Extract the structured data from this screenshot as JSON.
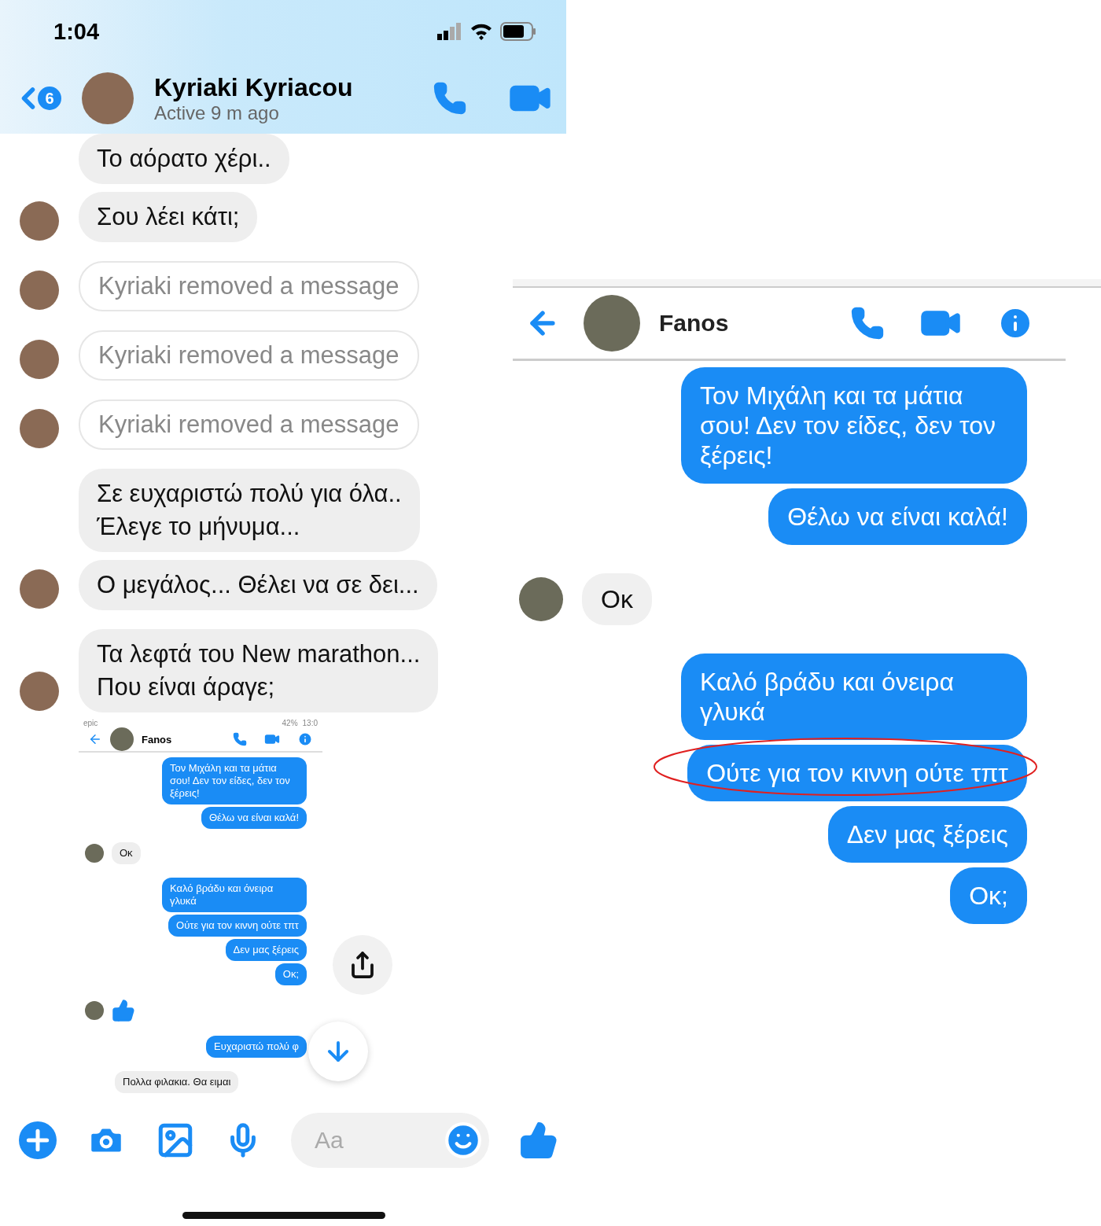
{
  "status_bar": {
    "time": "1:04"
  },
  "header": {
    "back_count": "6",
    "name": "Kyriaki Kyriacou",
    "status": "Active 9 m ago"
  },
  "messages": [
    {
      "kind": "text",
      "avatar": false,
      "text": "Το αόρατο χέρι.."
    },
    {
      "kind": "text",
      "avatar": true,
      "text": "Σου λέει κάτι;"
    },
    {
      "kind": "removed",
      "avatar": true,
      "text": "Kyriaki removed a message"
    },
    {
      "kind": "removed",
      "avatar": true,
      "text": "Kyriaki removed a message"
    },
    {
      "kind": "removed",
      "avatar": true,
      "text": "Kyriaki removed a message"
    },
    {
      "kind": "text",
      "avatar": false,
      "text": "Σε ευχαριστώ πολύ για όλα..\nΈλεγε το μήνυμα..."
    },
    {
      "kind": "text",
      "avatar": true,
      "text": "Ο μεγάλος... Θέλει να σε δει..."
    },
    {
      "kind": "text",
      "avatar": true,
      "text": "Τα λεφτά του New marathon...\nΠου είναι άραγε;"
    }
  ],
  "shared_screenshot": {
    "status_left": "epic",
    "battery": "42%",
    "time": "13:0",
    "contact": "Fanos",
    "messages": [
      {
        "kind": "sent",
        "text": "Τον Μιχάλη και τα μάτια σου! Δεν τον είδες, δεν τον ξέρεις!"
      },
      {
        "kind": "sent",
        "text": "Θέλω να είναι καλά!"
      },
      {
        "kind": "received",
        "text": "Οκ"
      },
      {
        "kind": "sent",
        "text": "Καλό βράδυ και όνειρα γλυκά"
      },
      {
        "kind": "sent",
        "text": "Ούτε για τον κιννη ούτε τπτ"
      },
      {
        "kind": "sent",
        "text": "Δεν μας ξέρεις"
      },
      {
        "kind": "sent",
        "text": "Οκ;"
      },
      {
        "kind": "like"
      },
      {
        "kind": "sent",
        "text": "Ευχαριστώ πολύ φ"
      },
      {
        "kind": "received",
        "text": "Πολλα φιλακια. Θα ειμαι"
      }
    ]
  },
  "composer": {
    "placeholder": "Aa"
  },
  "zoomed_screenshot": {
    "contact": "Fanos",
    "messages": [
      {
        "kind": "sent",
        "text": "Τον Μιχάλη και τα μάτια σου! Δεν τον είδες, δεν τον ξέρεις!",
        "highlighted": false
      },
      {
        "kind": "sent",
        "text": "Θέλω να είναι καλά!",
        "highlighted": false
      },
      {
        "kind": "received",
        "text": "Οκ",
        "highlighted": false
      },
      {
        "kind": "sent",
        "text": "Καλό βράδυ και όνειρα γλυκά",
        "highlighted": false
      },
      {
        "kind": "sent",
        "text": "Ούτε για τον κιννη ούτε τπτ",
        "highlighted": true
      },
      {
        "kind": "sent",
        "text": "Δεν μας ξέρεις",
        "highlighted": false
      },
      {
        "kind": "sent",
        "text": "Οκ;",
        "highlighted": false
      }
    ]
  }
}
